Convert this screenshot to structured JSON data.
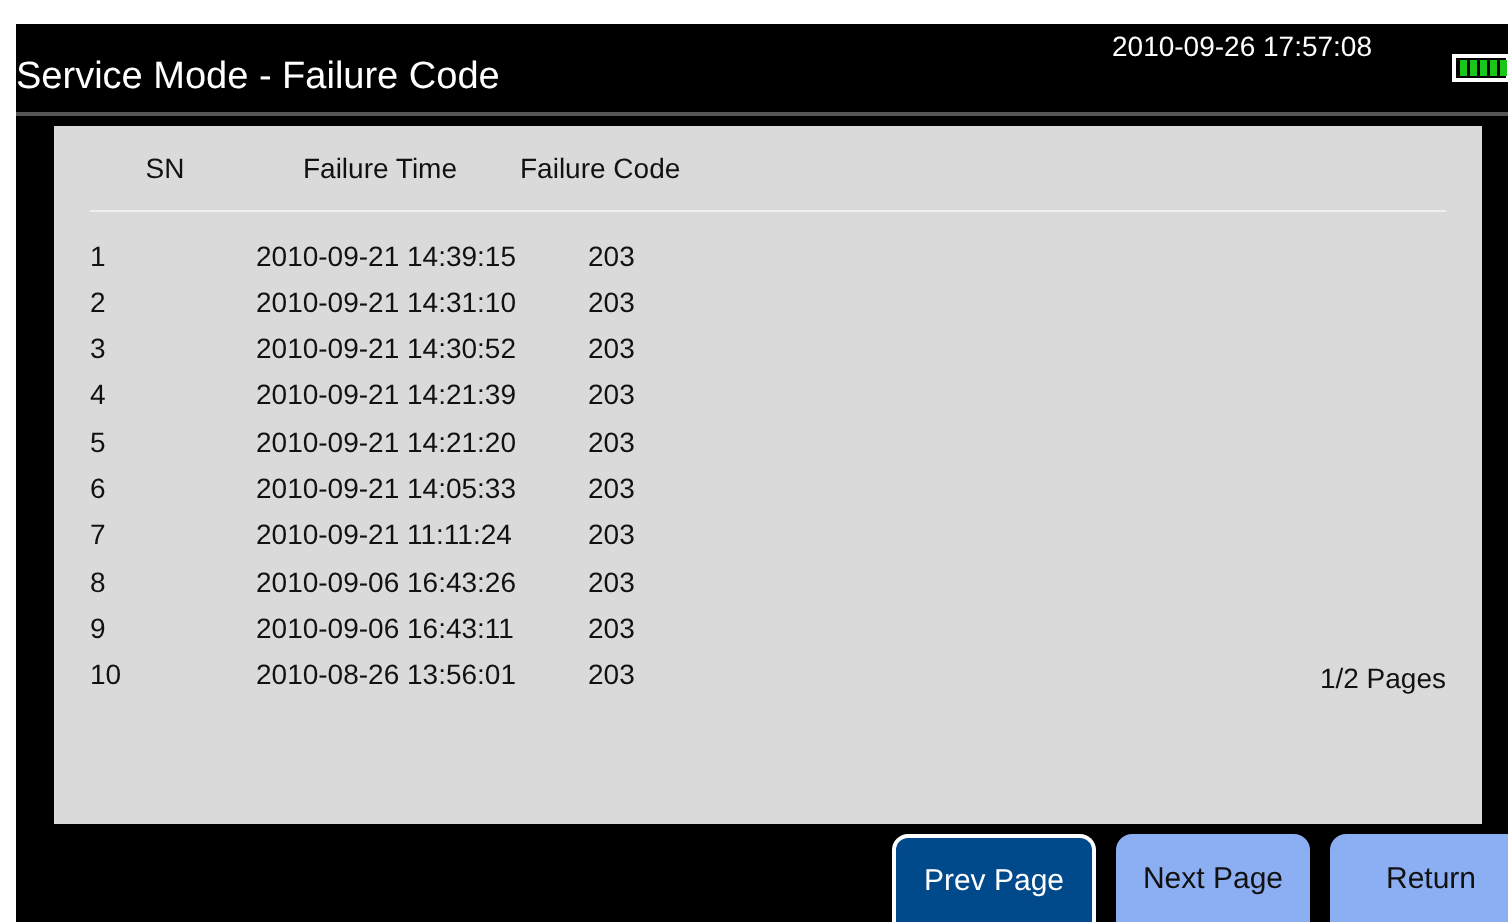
{
  "window": {
    "title": "Service Mode - Failure Code",
    "datetime": "2010-09-26 17:57:08"
  },
  "table": {
    "columns": [
      "SN",
      "Failure Time",
      "Failure Code"
    ],
    "rows": [
      [
        "1",
        "2010-09-21 14:39:15",
        "203"
      ],
      [
        "2",
        "2010-09-21 14:31:10",
        "203"
      ],
      [
        "3",
        "2010-09-21 14:30:52",
        "203"
      ],
      [
        "4",
        "2010-09-21 14:21:39",
        "203"
      ],
      [
        "5",
        "2010-09-21 14:21:20",
        "203"
      ],
      [
        "6",
        "2010-09-21 14:05:33",
        "203"
      ],
      [
        "7",
        "2010-09-21 11:11:24",
        "203"
      ],
      [
        "8",
        "2010-09-06 16:43:26",
        "203"
      ],
      [
        "9",
        "2010-09-06 16:43:11",
        "203"
      ],
      [
        "10",
        "2010-08-26 13:56:01",
        "203"
      ]
    ]
  },
  "pager": "1/2 Pages",
  "buttons": [
    {
      "label": "Prev Page",
      "selected": true
    },
    {
      "label": "Next Page",
      "selected": false
    },
    {
      "label": "Return",
      "selected": false
    }
  ]
}
